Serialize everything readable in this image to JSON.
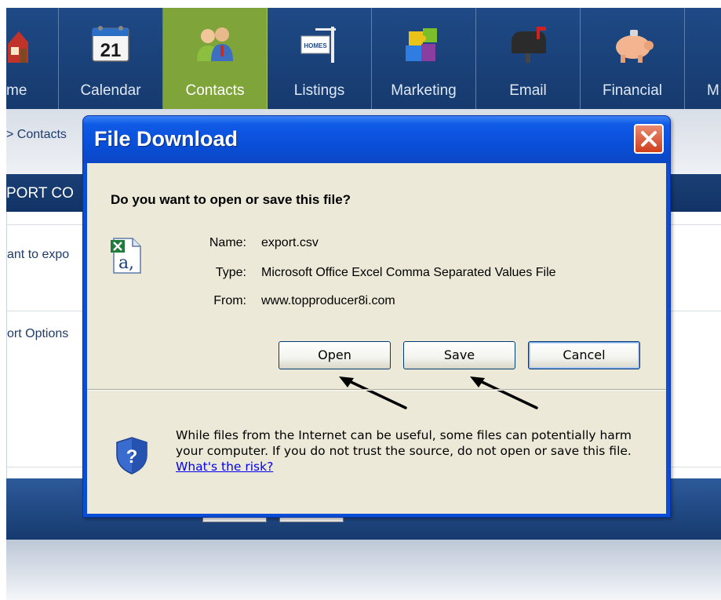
{
  "nav": {
    "items": [
      {
        "label": "me",
        "icon": "home-icon"
      },
      {
        "label": "Calendar",
        "icon": "calendar-icon"
      },
      {
        "label": "Contacts",
        "icon": "contacts-icon",
        "active": true
      },
      {
        "label": "Listings",
        "icon": "listings-sign-icon"
      },
      {
        "label": "Marketing",
        "icon": "puzzle-icon"
      },
      {
        "label": "Email",
        "icon": "mailbox-icon"
      },
      {
        "label": "Financial",
        "icon": "piggy-bank-icon"
      },
      {
        "label": "M",
        "icon": ""
      }
    ],
    "calendar_day": "21",
    "sign_text": "HOMES"
  },
  "breadcrumb": "> Contacts",
  "section_title": "PORT CO",
  "content": {
    "row1": "ant to expo",
    "row2": "ort Options"
  },
  "dialog": {
    "title": "File Download",
    "question": "Do you want to open or save this file?",
    "file": {
      "name_label": "Name:",
      "name_value": "export.csv",
      "type_label": "Type:",
      "type_value": "Microsoft Office Excel Comma Separated Values File",
      "from_label": "From:",
      "from_value": "www.topproducer8i.com"
    },
    "buttons": {
      "open": "Open",
      "save": "Save",
      "cancel": "Cancel"
    },
    "warning_text": "While files from the Internet can be useful, some files can potentially harm your computer. If you do not trust the source, do not open or save this file.",
    "risk_link": "What's the risk?"
  },
  "colors": {
    "nav_bg": "#1f4a86",
    "nav_active": "#7fa43a",
    "dialog_frame": "#0a4ed8",
    "dialog_body": "#ece9d8",
    "close_red": "#cf3f1c",
    "link": "#0000ee"
  }
}
